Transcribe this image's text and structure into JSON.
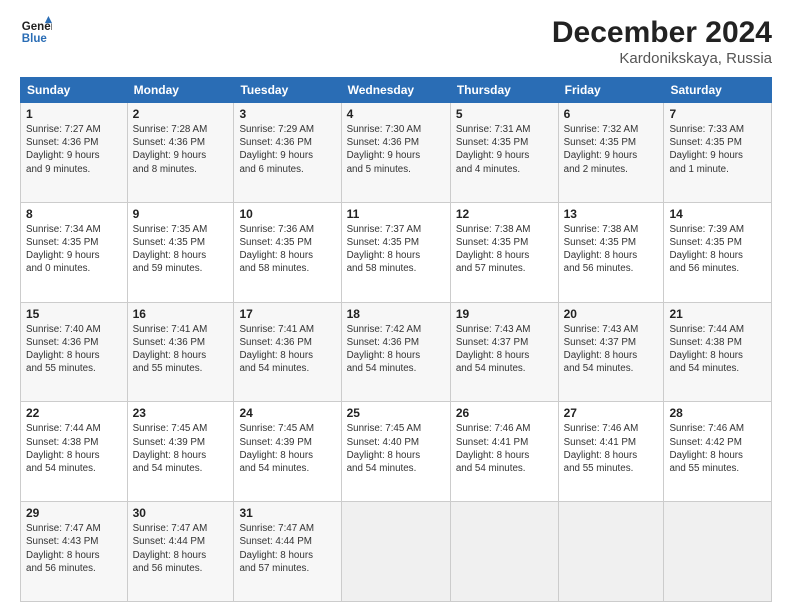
{
  "header": {
    "logo_line1": "General",
    "logo_line2": "Blue",
    "title": "December 2024",
    "subtitle": "Kardonikskaya, Russia"
  },
  "days_of_week": [
    "Sunday",
    "Monday",
    "Tuesday",
    "Wednesday",
    "Thursday",
    "Friday",
    "Saturday"
  ],
  "weeks": [
    [
      {
        "day": "1",
        "info": "Sunrise: 7:27 AM\nSunset: 4:36 PM\nDaylight: 9 hours\nand 9 minutes."
      },
      {
        "day": "2",
        "info": "Sunrise: 7:28 AM\nSunset: 4:36 PM\nDaylight: 9 hours\nand 8 minutes."
      },
      {
        "day": "3",
        "info": "Sunrise: 7:29 AM\nSunset: 4:36 PM\nDaylight: 9 hours\nand 6 minutes."
      },
      {
        "day": "4",
        "info": "Sunrise: 7:30 AM\nSunset: 4:36 PM\nDaylight: 9 hours\nand 5 minutes."
      },
      {
        "day": "5",
        "info": "Sunrise: 7:31 AM\nSunset: 4:35 PM\nDaylight: 9 hours\nand 4 minutes."
      },
      {
        "day": "6",
        "info": "Sunrise: 7:32 AM\nSunset: 4:35 PM\nDaylight: 9 hours\nand 2 minutes."
      },
      {
        "day": "7",
        "info": "Sunrise: 7:33 AM\nSunset: 4:35 PM\nDaylight: 9 hours\nand 1 minute."
      }
    ],
    [
      {
        "day": "8",
        "info": "Sunrise: 7:34 AM\nSunset: 4:35 PM\nDaylight: 9 hours\nand 0 minutes."
      },
      {
        "day": "9",
        "info": "Sunrise: 7:35 AM\nSunset: 4:35 PM\nDaylight: 8 hours\nand 59 minutes."
      },
      {
        "day": "10",
        "info": "Sunrise: 7:36 AM\nSunset: 4:35 PM\nDaylight: 8 hours\nand 58 minutes."
      },
      {
        "day": "11",
        "info": "Sunrise: 7:37 AM\nSunset: 4:35 PM\nDaylight: 8 hours\nand 58 minutes."
      },
      {
        "day": "12",
        "info": "Sunrise: 7:38 AM\nSunset: 4:35 PM\nDaylight: 8 hours\nand 57 minutes."
      },
      {
        "day": "13",
        "info": "Sunrise: 7:38 AM\nSunset: 4:35 PM\nDaylight: 8 hours\nand 56 minutes."
      },
      {
        "day": "14",
        "info": "Sunrise: 7:39 AM\nSunset: 4:35 PM\nDaylight: 8 hours\nand 56 minutes."
      }
    ],
    [
      {
        "day": "15",
        "info": "Sunrise: 7:40 AM\nSunset: 4:36 PM\nDaylight: 8 hours\nand 55 minutes."
      },
      {
        "day": "16",
        "info": "Sunrise: 7:41 AM\nSunset: 4:36 PM\nDaylight: 8 hours\nand 55 minutes."
      },
      {
        "day": "17",
        "info": "Sunrise: 7:41 AM\nSunset: 4:36 PM\nDaylight: 8 hours\nand 54 minutes."
      },
      {
        "day": "18",
        "info": "Sunrise: 7:42 AM\nSunset: 4:36 PM\nDaylight: 8 hours\nand 54 minutes."
      },
      {
        "day": "19",
        "info": "Sunrise: 7:43 AM\nSunset: 4:37 PM\nDaylight: 8 hours\nand 54 minutes."
      },
      {
        "day": "20",
        "info": "Sunrise: 7:43 AM\nSunset: 4:37 PM\nDaylight: 8 hours\nand 54 minutes."
      },
      {
        "day": "21",
        "info": "Sunrise: 7:44 AM\nSunset: 4:38 PM\nDaylight: 8 hours\nand 54 minutes."
      }
    ],
    [
      {
        "day": "22",
        "info": "Sunrise: 7:44 AM\nSunset: 4:38 PM\nDaylight: 8 hours\nand 54 minutes."
      },
      {
        "day": "23",
        "info": "Sunrise: 7:45 AM\nSunset: 4:39 PM\nDaylight: 8 hours\nand 54 minutes."
      },
      {
        "day": "24",
        "info": "Sunrise: 7:45 AM\nSunset: 4:39 PM\nDaylight: 8 hours\nand 54 minutes."
      },
      {
        "day": "25",
        "info": "Sunrise: 7:45 AM\nSunset: 4:40 PM\nDaylight: 8 hours\nand 54 minutes."
      },
      {
        "day": "26",
        "info": "Sunrise: 7:46 AM\nSunset: 4:41 PM\nDaylight: 8 hours\nand 54 minutes."
      },
      {
        "day": "27",
        "info": "Sunrise: 7:46 AM\nSunset: 4:41 PM\nDaylight: 8 hours\nand 55 minutes."
      },
      {
        "day": "28",
        "info": "Sunrise: 7:46 AM\nSunset: 4:42 PM\nDaylight: 8 hours\nand 55 minutes."
      }
    ],
    [
      {
        "day": "29",
        "info": "Sunrise: 7:47 AM\nSunset: 4:43 PM\nDaylight: 8 hours\nand 56 minutes."
      },
      {
        "day": "30",
        "info": "Sunrise: 7:47 AM\nSunset: 4:44 PM\nDaylight: 8 hours\nand 56 minutes."
      },
      {
        "day": "31",
        "info": "Sunrise: 7:47 AM\nSunset: 4:44 PM\nDaylight: 8 hours\nand 57 minutes."
      },
      {
        "day": "",
        "info": ""
      },
      {
        "day": "",
        "info": ""
      },
      {
        "day": "",
        "info": ""
      },
      {
        "day": "",
        "info": ""
      }
    ]
  ]
}
